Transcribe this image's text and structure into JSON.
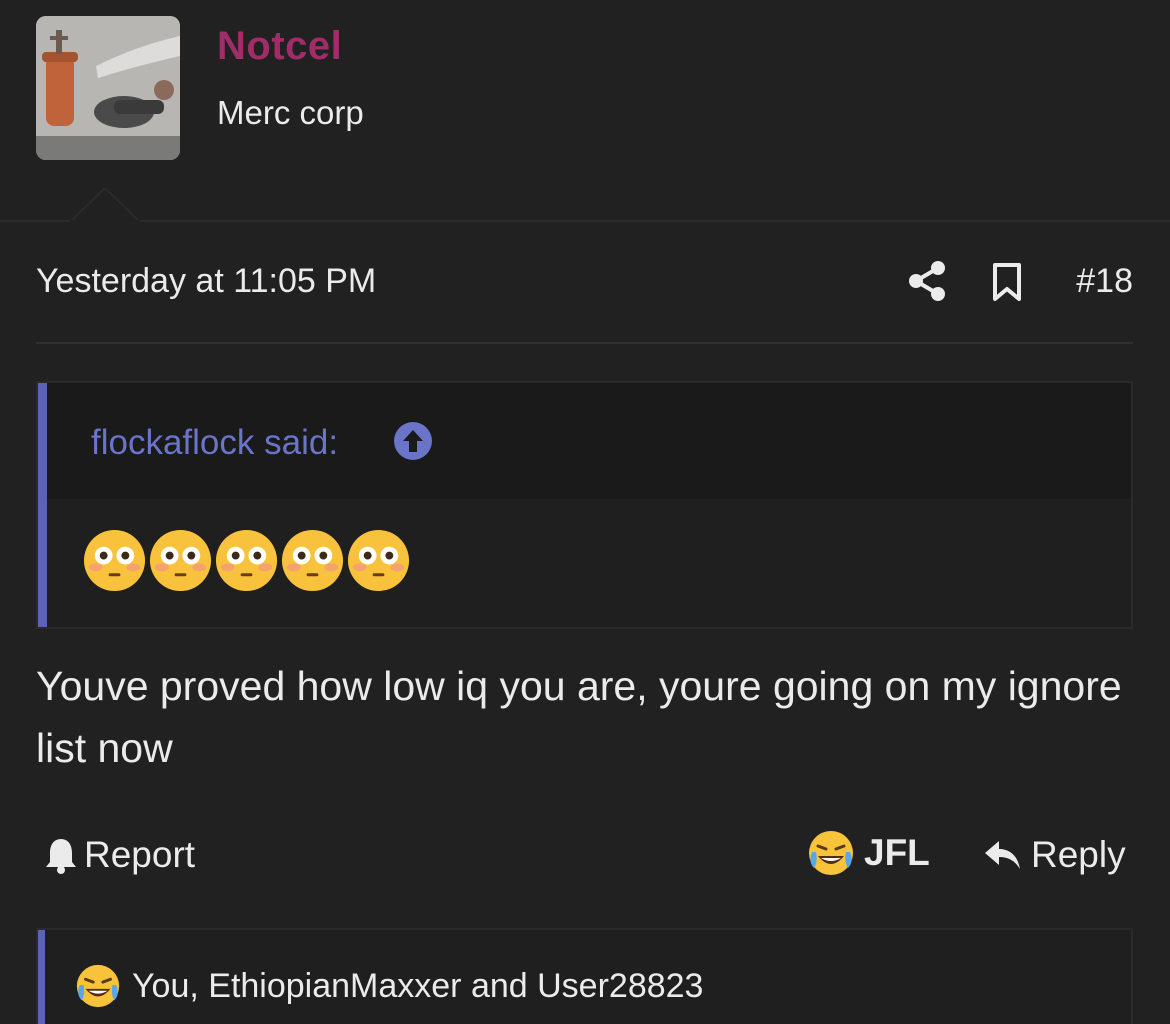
{
  "user": {
    "name": "Notcel",
    "title": "Merc corp",
    "name_color": "#a02d68"
  },
  "post": {
    "timestamp": "Yesterday at 11:05 PM",
    "number": "#18",
    "body": "Youve proved how low iq you are, youre going on my ignore list now",
    "icons": [
      "share-icon",
      "bookmark-icon"
    ]
  },
  "quote": {
    "attribution": "flockaflock said:",
    "emoji_count": 5,
    "emoji": "flushed-face",
    "accent_color": "#5c63b7",
    "attrib_color": "#6a74c9"
  },
  "actions": {
    "report_label": "Report",
    "jfl_label": "JFL",
    "reply_label": "Reply"
  },
  "reactions": {
    "text": "You, EthiopianMaxxer and User28823",
    "emoji": "laughing-crying-face"
  }
}
